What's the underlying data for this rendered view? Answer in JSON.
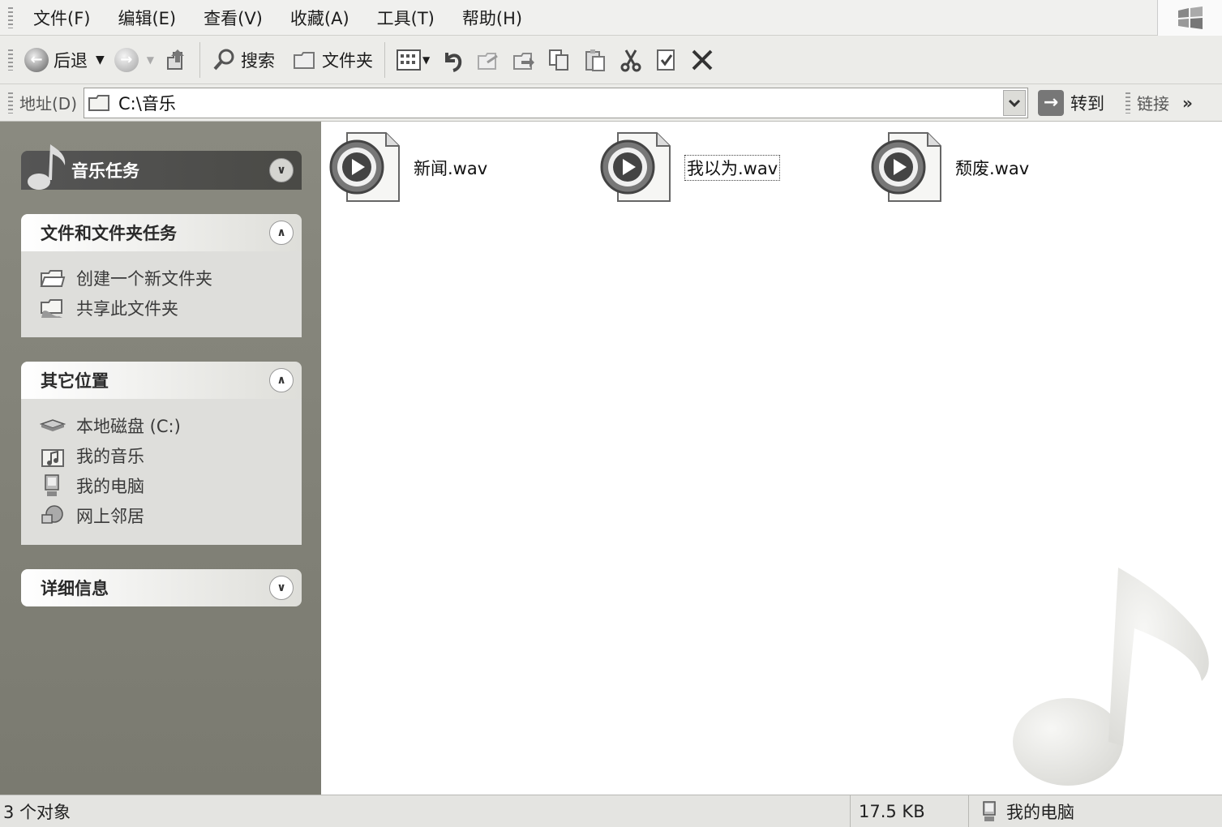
{
  "menu": {
    "items": [
      "文件(F)",
      "编辑(E)",
      "查看(V)",
      "收藏(A)",
      "工具(T)",
      "帮助(H)"
    ]
  },
  "toolbar": {
    "back_label": "后退",
    "search_label": "搜索",
    "folders_label": "文件夹"
  },
  "address": {
    "label": "地址(D)",
    "path": "C:\\音乐",
    "go_label": "转到",
    "links_label": "链接"
  },
  "sidebar": {
    "music_tasks": {
      "title": "音乐任务"
    },
    "file_tasks": {
      "title": "文件和文件夹任务",
      "items": [
        "创建一个新文件夹",
        "共享此文件夹"
      ]
    },
    "other_places": {
      "title": "其它位置",
      "items": [
        "本地磁盘 (C:)",
        "我的音乐",
        "我的电脑",
        "网上邻居"
      ]
    },
    "details": {
      "title": "详细信息"
    }
  },
  "files": [
    {
      "name": "新闻.wav"
    },
    {
      "name": "我以为.wav"
    },
    {
      "name": "颓废.wav"
    }
  ],
  "status": {
    "count": "3 个对象",
    "size": "17.5 KB",
    "location": "我的电脑"
  }
}
